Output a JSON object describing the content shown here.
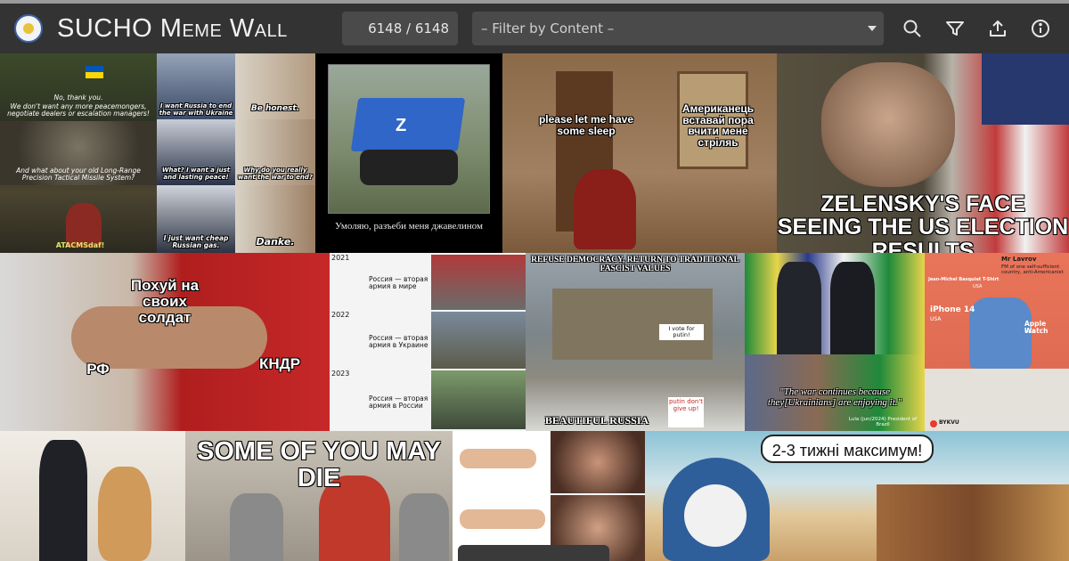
{
  "app": {
    "title_first": "SUCHO",
    "title_rest": "Meme Wall"
  },
  "toolbar": {
    "counter": "6148 / 6148",
    "filter_placeholder": "– Filter by Content –",
    "icons": [
      "search-icon",
      "filter-icon",
      "upload-icon",
      "info-icon"
    ]
  },
  "memes": {
    "gandalf": {
      "line1": "No, thank you.",
      "line2": "We don't want any more peacemongers, negotiate dealers or escalation managers!",
      "line3": "And what about your old Long-Range Precision Tactical Missile System?",
      "line4": "ATACMSdaf!"
    },
    "scholz": {
      "l1": "I want Russia to end the war with Ukraine",
      "r1": "Be honest.",
      "l2": "What? I want a just and lasting peace!",
      "r2": "Why do you really want the war to end?",
      "l3": "I just want cheap Russian gas.",
      "r3": "Danke."
    },
    "robot": {
      "caption": "Умоляю, разъеби меня джавелином"
    },
    "sleep": {
      "left": "please let me have some sleep",
      "right": "Американець вставай пора вчити мене стріляь"
    },
    "zelensky": {
      "caption": "ZELENSKY'S FACE SEEING THE US ELECTION RESULTS"
    },
    "handshake": {
      "top": "Похуй на своих солдат",
      "left": "РФ",
      "right": "КНДР"
    },
    "army": {
      "y1": "2021",
      "t1": "Россия — вторая армия в мире",
      "y2": "2022",
      "t2": "Россия — вторая армия в Украине",
      "y3": "2023",
      "t3": "Россия — вторая армия в России"
    },
    "fascist": {
      "top": "REFUSE DEMOCRACY, RETURN TO TRADITIONAL FASCIST VALUES",
      "sign1": "I vote for putin!",
      "sign2": "putin don't give up!",
      "bottom": "BEAUTIFUL RUSSIA"
    },
    "lula": {
      "quote": "\"The war continues because they[Ukrainians] are enjoying it.\"",
      "attrib": "Lula (jun/2024) President of Brazil"
    },
    "lavrov": {
      "name": "Mr Lavrov",
      "desc": "FM of one self-sufficient country, anti-Americanist",
      "shirt": "Jean-Michel Basquiat T-Shirt",
      "shirt_origin": "USA",
      "phone": "iPhone 14",
      "phone_origin": "USA",
      "watch": "Apple Watch",
      "watch_origin": "USA",
      "brand": "BYKVU"
    },
    "die": {
      "caption": "SOME OF YOU MAY DIE"
    },
    "moses": {
      "bubble": "2-3 тижні максимум!"
    }
  },
  "colors": {
    "navbar": "#333333",
    "input_bg": "#4a4a4a",
    "ukraine_blue": "#0057b7",
    "ukraine_yellow": "#ffd700"
  }
}
